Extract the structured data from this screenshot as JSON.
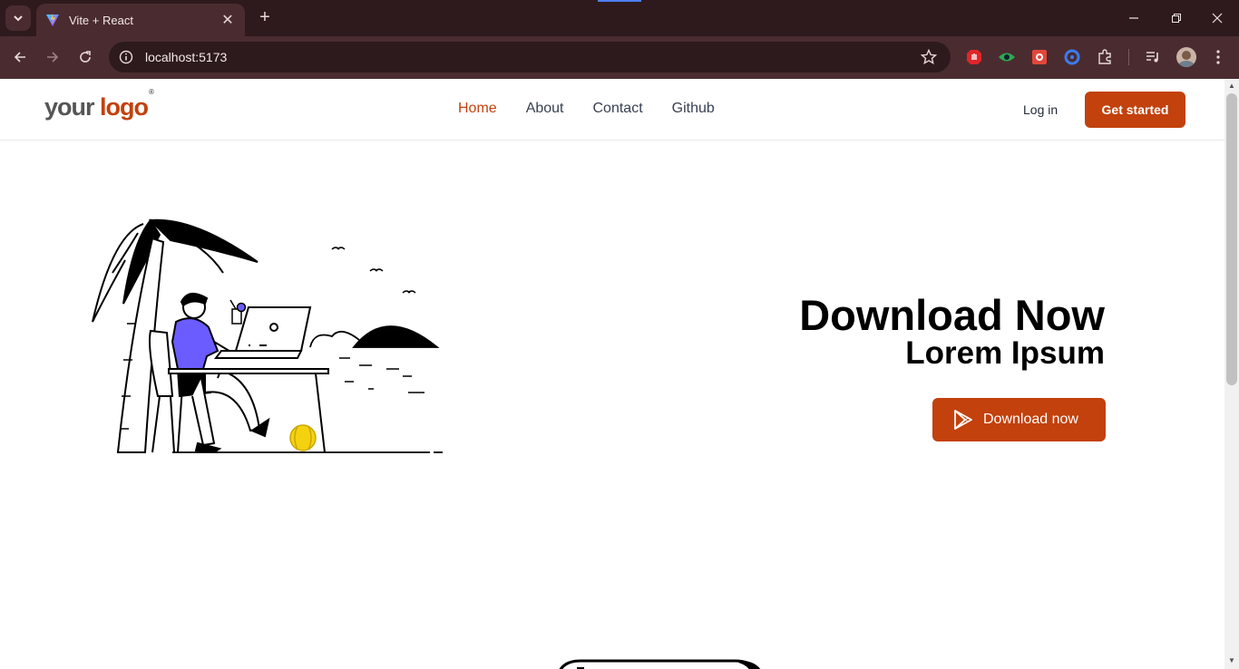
{
  "browser": {
    "tab_title": "Vite + React",
    "url": "localhost:5173"
  },
  "site": {
    "logo_main": "your",
    "logo_accent": "logo",
    "logo_mark": "®",
    "nav": [
      {
        "label": "Home"
      },
      {
        "label": "About"
      },
      {
        "label": "Contact"
      },
      {
        "label": "Github"
      }
    ],
    "login_label": "Log in",
    "cta_label": "Get started"
  },
  "hero": {
    "title": "Download Now",
    "subtitle": "Lorem Ipsum",
    "button_label": "Download now"
  },
  "colors": {
    "accent": "#c2410c",
    "chrome_bg": "#3c1f22",
    "illustration_shirt": "#6b5cff",
    "illustration_ball": "#f5d20f"
  },
  "icons": {
    "tab_search": "chevron-down-icon",
    "favicon": "vite-icon",
    "download_button": "play-store-icon"
  }
}
